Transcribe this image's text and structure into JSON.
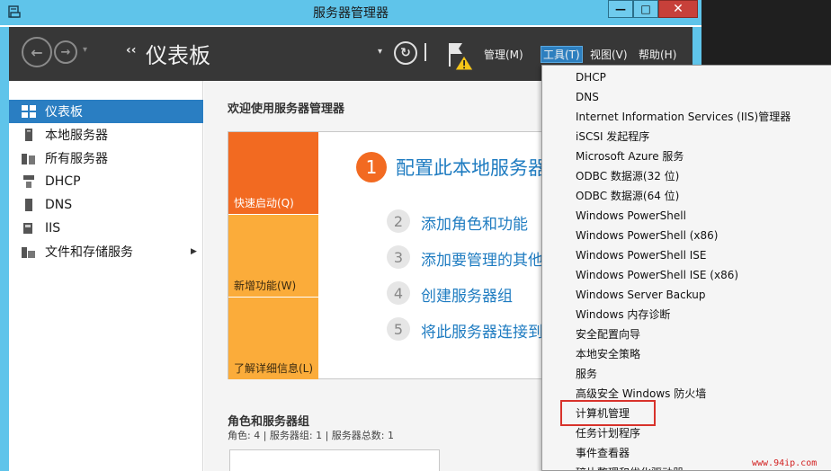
{
  "window": {
    "title": "服务器管理器",
    "min_glyph": "—",
    "max_glyph": "□",
    "close_glyph": "✕"
  },
  "header": {
    "page_title": "仪表板",
    "breadcrumb_chevron": "‹‹",
    "back_glyph": "←",
    "forward_glyph": "→",
    "nav_dropdown_glyph": "▾",
    "refresh_dropdown_glyph": "▾",
    "refresh_glyph": "↻",
    "menus": [
      "管理(M)",
      "工具(T)",
      "视图(V)",
      "帮助(H)"
    ],
    "active_menu": "工具(T)"
  },
  "sidebar": {
    "items": [
      {
        "label": "仪表板",
        "icon": "dashboard-icon",
        "active": true
      },
      {
        "label": "本地服务器",
        "icon": "server-icon",
        "active": false
      },
      {
        "label": "所有服务器",
        "icon": "servers-icon",
        "active": false
      },
      {
        "label": "DHCP",
        "icon": "dhcp-icon",
        "active": false
      },
      {
        "label": "DNS",
        "icon": "dns-icon",
        "active": false
      },
      {
        "label": "IIS",
        "icon": "iis-icon",
        "active": false
      },
      {
        "label": "文件和存储服务",
        "icon": "storage-icon",
        "active": false,
        "has_submenu": true
      }
    ],
    "submenu_arrow": "▶"
  },
  "main": {
    "welcome": "欢迎使用服务器管理器",
    "tiles": [
      "快速启动(Q)",
      "新增功能(W)",
      "了解详细信息(L)"
    ],
    "step1": {
      "num": "1",
      "text": "配置此本地服务器"
    },
    "steps": [
      {
        "num": "2",
        "text": "添加角色和功能"
      },
      {
        "num": "3",
        "text": "添加要管理的其他服务器"
      },
      {
        "num": "4",
        "text": "创建服务器组"
      },
      {
        "num": "5",
        "text": "将此服务器连接到云服务"
      }
    ],
    "roles_title": "角色和服务器组",
    "roles_sub": "角色: 4 | 服务器组: 1 | 服务器总数: 1"
  },
  "tools_menu": {
    "items": [
      "DHCP",
      "DNS",
      "Internet Information Services (IIS)管理器",
      "iSCSI 发起程序",
      "Microsoft Azure 服务",
      "ODBC 数据源(32 位)",
      "ODBC 数据源(64 位)",
      "Windows PowerShell",
      "Windows PowerShell (x86)",
      "Windows PowerShell ISE",
      "Windows PowerShell ISE (x86)",
      "Windows Server Backup",
      "Windows 内存诊断",
      "安全配置向导",
      "本地安全策略",
      "服务",
      "高级安全 Windows 防火墙",
      "计算机管理",
      "任务计划程序",
      "事件查看器",
      "碎片整理和优化驱动器"
    ],
    "highlighted": "计算机管理",
    "highlight_color": "#d8322b"
  },
  "watermark": "www.94ip.com",
  "colors": {
    "titlebar": "#5fc4ea",
    "header": "#373737",
    "accent": "#2a7ec2",
    "orange": "#f26a21",
    "light_orange": "#fbac3a",
    "link": "#1f7cc1"
  }
}
